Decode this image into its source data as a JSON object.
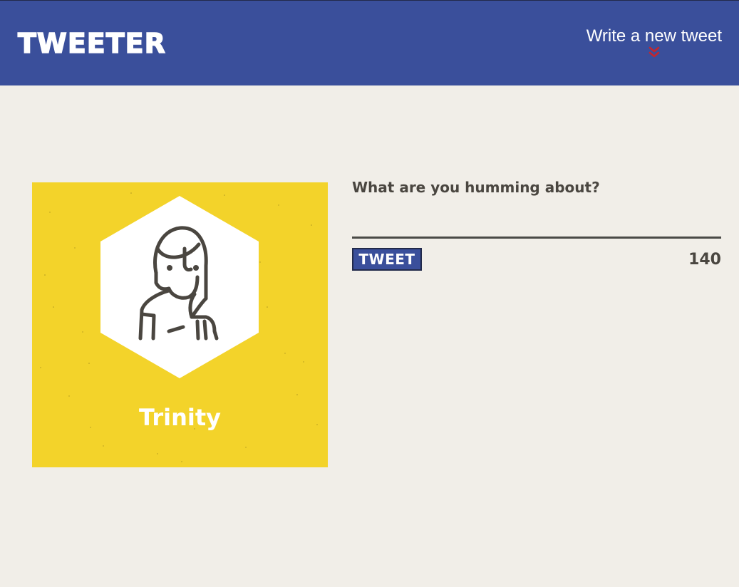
{
  "nav": {
    "brand": "TWEETER",
    "compose_label": "Write a new tweet",
    "compose_icon": "double-chevron-down-icon",
    "compose_icon_color": "#c4262d"
  },
  "profile": {
    "name": "Trinity",
    "avatar_icon": "person-avatar-icon",
    "card_color": "#f3d32a"
  },
  "composer": {
    "placeholder": "What are you humming about?",
    "value": "",
    "submit_label": "TWEET",
    "char_count": "140"
  },
  "colors": {
    "nav_background": "#3a4f9b",
    "page_background": "#f1eee8",
    "text_dark": "#4a4640"
  }
}
